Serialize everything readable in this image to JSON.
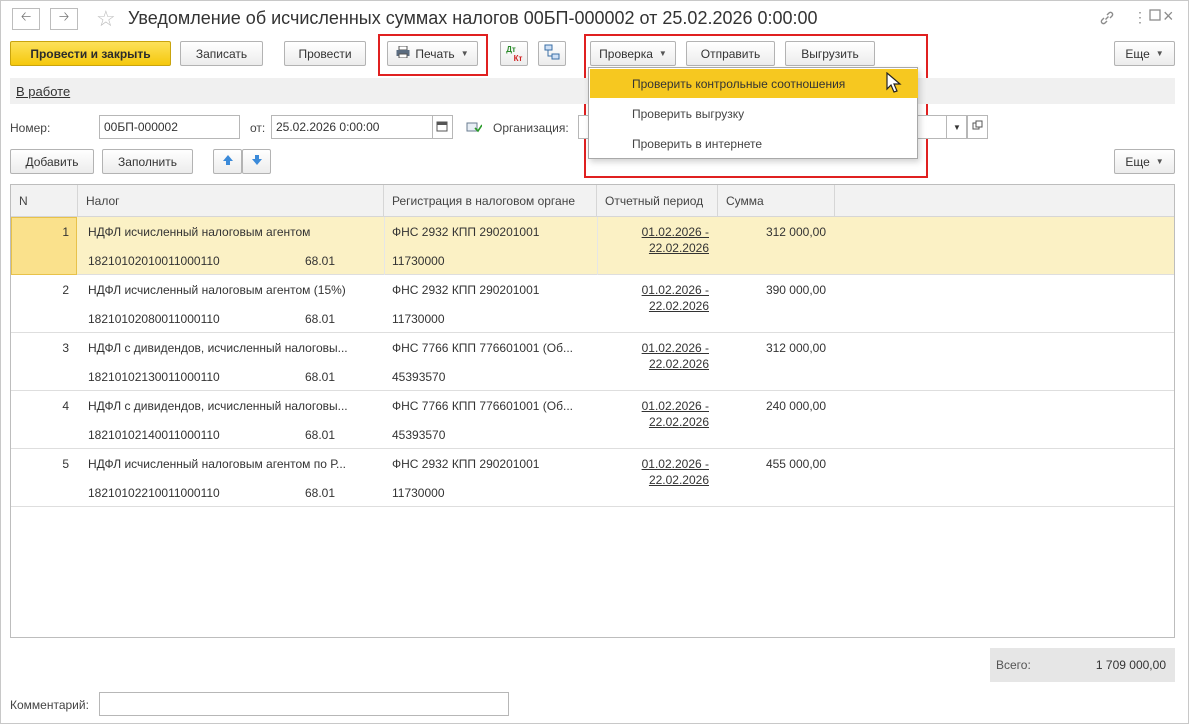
{
  "window": {
    "title": "Уведомление об исчисленных суммах налогов 00БП-000002 от 25.02.2026 0:00:00",
    "nav_back_icon": "arrow-left-icon",
    "nav_forward_icon": "arrow-right-icon",
    "favorite_icon": "star-icon",
    "window_icons": [
      "link-icon",
      "more-vertical-icon",
      "maximize-icon",
      "close-icon"
    ]
  },
  "toolbar": {
    "post_close": "Провести и закрыть",
    "save": "Записать",
    "post": "Провести",
    "print": "Печать",
    "dt_kt_top": "Дт",
    "dt_kt_bottom": "Кт",
    "check": "Проверка",
    "send": "Отправить",
    "export": "Выгрузить",
    "more": "Еще"
  },
  "status": {
    "label": "В работе"
  },
  "form": {
    "number_label": "Номер:",
    "number_value": "00БП-000002",
    "date_label": "от:",
    "date_value": "25.02.2026  0:00:00",
    "org_label": "Организация:"
  },
  "table_toolbar": {
    "add": "Добавить",
    "fill": "Заполнить",
    "more": "Еще"
  },
  "table": {
    "columns": [
      "N",
      "Налог",
      "Регистрация в налоговом органе",
      "Отчетный период",
      "Сумма"
    ],
    "rows": [
      {
        "n": "1",
        "tax": "НДФЛ исчисленный налоговым агентом",
        "kbk": "18210102010011000110",
        "account": "68.01",
        "reg": "ФНС 2932 КПП 290201001",
        "oktmo": "11730000",
        "period1": "01.02.2026 -",
        "period2": "22.02.2026",
        "sum": "312 000,00"
      },
      {
        "n": "2",
        "tax": "НДФЛ исчисленный налоговым агентом (15%)",
        "kbk": "18210102080011000110",
        "account": "68.01",
        "reg": "ФНС 2932 КПП 290201001",
        "oktmo": "11730000",
        "period1": "01.02.2026 -",
        "period2": "22.02.2026",
        "sum": "390 000,00"
      },
      {
        "n": "3",
        "tax": "НДФЛ с дивидендов, исчисленный налоговы...",
        "kbk": "18210102130011000110",
        "account": "68.01",
        "reg": "ФНС 7766 КПП 776601001 (Об...",
        "oktmo": "45393570",
        "period1": "01.02.2026 -",
        "period2": "22.02.2026",
        "sum": "312 000,00"
      },
      {
        "n": "4",
        "tax": "НДФЛ с дивидендов, исчисленный налоговы...",
        "kbk": "18210102140011000110",
        "account": "68.01",
        "reg": "ФНС 7766 КПП 776601001 (Об...",
        "oktmo": "45393570",
        "period1": "01.02.2026 -",
        "period2": "22.02.2026",
        "sum": "240 000,00"
      },
      {
        "n": "5",
        "tax": "НДФЛ исчисленный налоговым агентом по Р...",
        "kbk": "18210102210011000110",
        "account": "68.01",
        "reg": "ФНС 2932 КПП 290201001",
        "oktmo": "11730000",
        "period1": "01.02.2026 -",
        "period2": "22.02.2026",
        "sum": "455 000,00"
      }
    ]
  },
  "total": {
    "label": "Всего:",
    "value": "1 709 000,00"
  },
  "comment": {
    "label": "Комментарий:",
    "value": ""
  },
  "check_menu": {
    "items": [
      "Проверить контрольные соотношения",
      "Проверить выгрузку",
      "Проверить в интернете"
    ],
    "active_index": 0
  },
  "colors": {
    "accent": "#f6c820",
    "highlight_box": "#e02020",
    "selected_row": "#fbf1c5"
  }
}
